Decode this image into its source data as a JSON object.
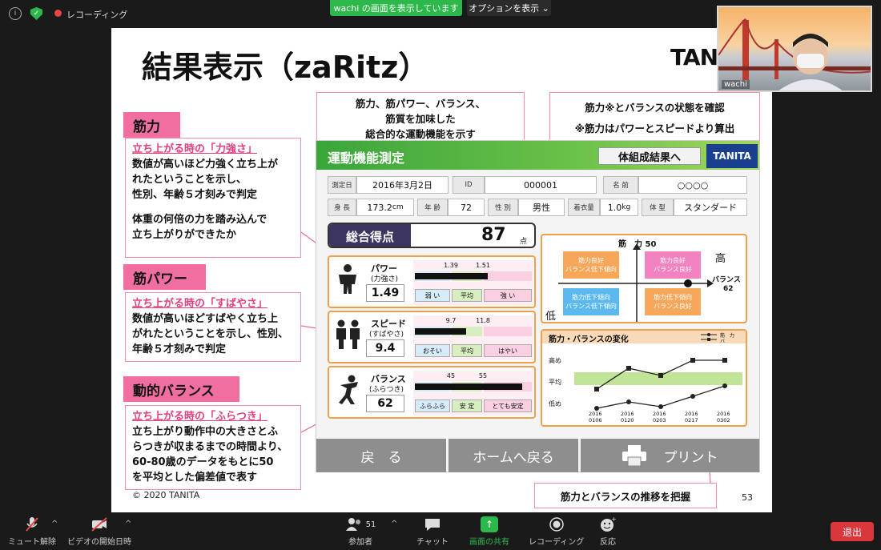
{
  "topbar": {
    "recording_label": "レコーディング",
    "share_banner": "wachi の画面を表示しています",
    "options_label": "オプションを表示"
  },
  "video": {
    "name": "wachi"
  },
  "slide": {
    "title": "結果表示（zaRitz）",
    "logo": "TANITA",
    "copyright": "© 2020 TANITA",
    "page_number": "53",
    "sections": [
      {
        "label": "筋力",
        "heading": "立ち上がる時の「力強さ」",
        "body": [
          "数値が高いほど力強く立ち上が",
          "れたということを示し、",
          "性別、年齢５才刻みで判定",
          "",
          "体重の何倍の力を踏み込んで",
          "立ち上がりができたか"
        ]
      },
      {
        "label": "筋パワー",
        "heading": "立ち上がる時の「すばやさ」",
        "body": [
          "数値が高いほどすばやく立ち上",
          "がれたということを示し、性別、",
          "年齢５才刻みで判定"
        ]
      },
      {
        "label": "動的バランス",
        "heading": "立ち上がる時の「ふらつき」",
        "body": [
          "立ち上がり動作中の大きさとふ",
          "らつきが収まるまでの時間より、",
          "60-80歳のデータをもとに50",
          "を平均とした偏差値で表す"
        ]
      }
    ],
    "callouts": {
      "center_top": [
        "筋力、筋パワー、バランス、",
        "筋質を加味した",
        "総合的な運動機能を示す"
      ],
      "right_top": [
        "筋力※とバランスの状態を確認",
        "※筋力はパワーとスピードより算出"
      ],
      "bottom_right": "筋力とバランスの推移を把握"
    }
  },
  "app": {
    "header_title": "運動機能測定",
    "header_button": "体組成結果へ",
    "header_logo": "TANITA",
    "fields": {
      "date_label": "測定日",
      "date": "2016年3月2日",
      "id_label": "ID",
      "id": "000001",
      "name_label": "名 前",
      "name": "○○○○",
      "height_label": "身 長",
      "height": "173.2",
      "height_unit": "cm",
      "age_label": "年 齢",
      "age": "72",
      "gender_label": "性 別",
      "gender": "男性",
      "clothes_label": "着衣量",
      "clothes": "1.0",
      "clothes_unit": "kg",
      "type_label": "体 型",
      "type": "スタンダード"
    },
    "total": {
      "label": "総合得点",
      "value": "87",
      "unit": "点"
    },
    "metrics": [
      {
        "name": "パワー",
        "sub": "(力強さ)",
        "value": "1.49",
        "t1": "1.39",
        "t2": "1.51",
        "bins": [
          "弱 い",
          "平均",
          "強 い"
        ],
        "fill": 0.62
      },
      {
        "name": "スピード",
        "sub": "(すばやさ)",
        "value": "9.4",
        "t1": "9.7",
        "t2": "11.8",
        "bins": [
          "おそい",
          "平均",
          "はやい"
        ],
        "fill": 0.44
      },
      {
        "name": "バランス",
        "sub": "(ふらつき)",
        "value": "62",
        "t1": "45",
        "t2": "55",
        "bins": [
          "ふらふら",
          "安 定",
          "とても安定"
        ],
        "fill": 0.92
      }
    ],
    "quadrant": {
      "top_label": "筋　力 50",
      "high": "高",
      "low": "低",
      "balance_label": "バランス",
      "balance_value": "62",
      "cells": [
        "筋力良好\nバランス低下傾向",
        "筋力良好\nバランス良好",
        "筋力低下傾向\nバランス低下傾向",
        "筋力低下傾向\nバランス良好"
      ]
    },
    "trend": {
      "title": "筋力・バランスの変化",
      "legend": [
        "筋　力",
        "バ"
      ],
      "levels": [
        "高め",
        "平均",
        "低め"
      ],
      "dates": [
        "2016\n0106",
        "2016\n0120",
        "2016\n0203",
        "2016\n0217",
        "2016\n0302"
      ]
    },
    "buttons": {
      "back": "戻　る",
      "home": "ホームへ戻る",
      "print": "プリント"
    }
  },
  "bottombar": {
    "mute": "ミュート解除",
    "video": "ビデオの開始日時",
    "participants": "参加者",
    "participants_count": "51",
    "chat": "チャット",
    "share": "画面の共有",
    "record": "レコーディング",
    "reactions": "反応",
    "leave": "退出"
  }
}
